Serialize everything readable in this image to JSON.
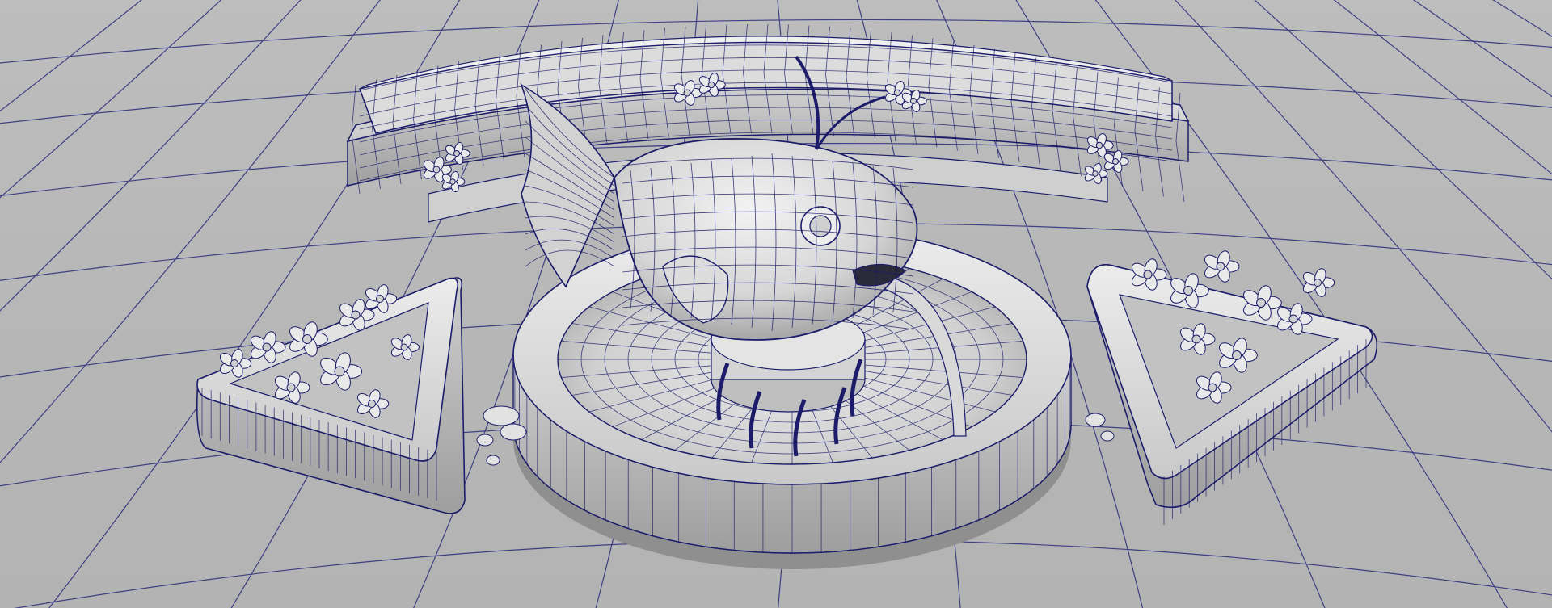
{
  "app": {
    "view": "3d-viewport",
    "shading": "wireframe-on-shaded",
    "grid": true
  },
  "colors": {
    "background": "#b8b8b8",
    "grid": "#2a2a7a",
    "wireframe": "#1c1c6a",
    "surface_light": "#e6e6e6",
    "surface_mid": "#cfcfcf",
    "surface_dark": "#9a9a9a",
    "shadow": "#5a5a5a"
  },
  "scene": {
    "objects": [
      {
        "name": "fish-fountain-sculpture"
      },
      {
        "name": "fountain-pool"
      },
      {
        "name": "curved-bench-planter"
      },
      {
        "name": "left-triangular-planter"
      },
      {
        "name": "right-triangular-planter"
      },
      {
        "name": "water-stream"
      },
      {
        "name": "flower-clusters"
      }
    ]
  }
}
